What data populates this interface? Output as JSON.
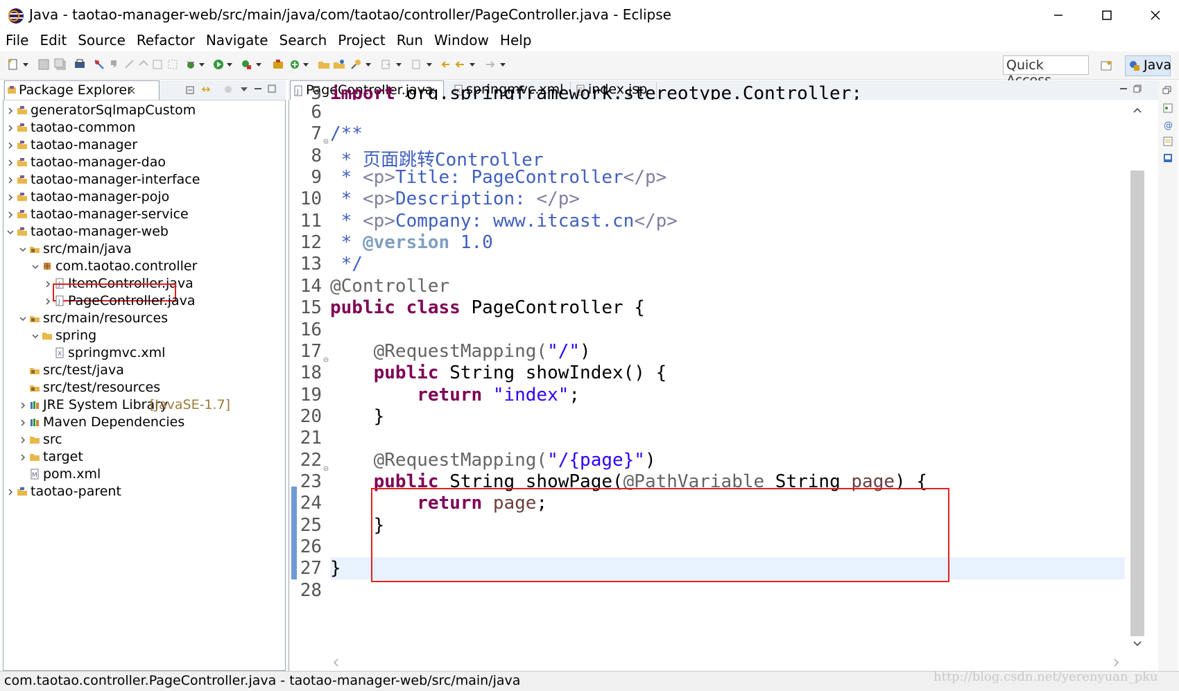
{
  "window": {
    "title": "Java - taotao-manager-web/src/main/java/com/taotao/controller/PageController.java - Eclipse"
  },
  "menu": [
    "File",
    "Edit",
    "Source",
    "Refactor",
    "Navigate",
    "Search",
    "Project",
    "Run",
    "Window",
    "Help"
  ],
  "toolbar": {
    "quick_access": "Quick Access",
    "perspective": "Java"
  },
  "package_explorer": {
    "title": "Package Explorer",
    "items": [
      {
        "label": "generatorSqlmapCustom",
        "icon": "project-icon"
      },
      {
        "label": "taotao-common",
        "icon": "project-icon"
      },
      {
        "label": "taotao-manager",
        "icon": "project-icon"
      },
      {
        "label": "taotao-manager-dao",
        "icon": "project-icon"
      },
      {
        "label": "taotao-manager-interface",
        "icon": "project-icon"
      },
      {
        "label": "taotao-manager-pojo",
        "icon": "project-icon"
      },
      {
        "label": "taotao-manager-service",
        "icon": "project-icon"
      },
      {
        "label": "taotao-manager-web",
        "icon": "project-icon"
      },
      {
        "label": "src/main/java",
        "icon": "source-folder-icon"
      },
      {
        "label": "com.taotao.controller",
        "icon": "package-icon"
      },
      {
        "label": "ItemController.java",
        "icon": "java-file-icon"
      },
      {
        "label": "PageController.java",
        "icon": "java-file-icon"
      },
      {
        "label": "src/main/resources",
        "icon": "source-folder-icon"
      },
      {
        "label": "spring",
        "icon": "folder-icon"
      },
      {
        "label": "springmvc.xml",
        "icon": "xml-file-icon"
      },
      {
        "label": "src/test/java",
        "icon": "source-folder-icon"
      },
      {
        "label": "src/test/resources",
        "icon": "source-folder-icon"
      },
      {
        "label": "JRE System Library",
        "suffix": "[JavaSE-1.7]",
        "icon": "library-icon"
      },
      {
        "label": "Maven Dependencies",
        "icon": "library-icon"
      },
      {
        "label": "src",
        "icon": "folder-icon"
      },
      {
        "label": "target",
        "icon": "folder-icon"
      },
      {
        "label": "pom.xml",
        "icon": "xml-file-icon"
      },
      {
        "label": "taotao-parent",
        "icon": "project-icon"
      }
    ]
  },
  "editor": {
    "tabs": [
      {
        "label": "PageController.java",
        "active": true
      },
      {
        "label": "springmvc.xml",
        "active": false
      },
      {
        "label": "index.jsp",
        "active": false
      }
    ],
    "line_numbers": [
      "5",
      "6",
      "7",
      "8",
      "9",
      "10",
      "11",
      "12",
      "13",
      "14",
      "15",
      "16",
      "17",
      "18",
      "19",
      "20",
      "21",
      "22",
      "23",
      "24",
      "25",
      "26",
      "27",
      "28"
    ],
    "code": {
      "l5a": "import ",
      "l5b": "org.springframework.stereotype.Controller;",
      "l7": "/**",
      "l8": " * 页面跳转Controller",
      "l9a": " * ",
      "l9b": "<p>",
      "l9c": "Title: PageController",
      "l9d": "</p>",
      "l10a": " * ",
      "l10b": "<p>",
      "l10c": "Description: ",
      "l10d": "</p>",
      "l11a": " * ",
      "l11b": "<p>",
      "l11c": "Company: www.itcast.cn",
      "l11d": "</p>",
      "l12a": " * ",
      "l12b": "@version",
      "l12c": " 1.0",
      "l13": " */",
      "l14": "@Controller",
      "l15a": "public class",
      "l15b": " PageController {",
      "l17a": "    @RequestMapping(",
      "l17b": "\"/\"",
      "l17c": ")",
      "l18a": "    ",
      "l18b": "public",
      "l18c": " String showIndex() {",
      "l19a": "        ",
      "l19b": "return",
      "l19c": " ",
      "l19d": "\"index\"",
      "l19e": ";",
      "l20": "    }",
      "l22a": "    @RequestMapping(",
      "l22b": "\"/{page}\"",
      "l22c": ")",
      "l23a": "    ",
      "l23b": "public",
      "l23c": " String showPage(",
      "l23d": "@PathVariable",
      "l23e": " String ",
      "l23f": "page",
      "l23g": ") {",
      "l24a": "        ",
      "l24b": "return",
      "l24c": " ",
      "l24d": "page",
      "l24e": ";",
      "l25": "    }",
      "l27": "}"
    }
  },
  "status_bar": {
    "text": "com.taotao.controller.PageController.java - taotao-manager-web/src/main/java",
    "watermark": "http://blog.csdn.net/yerenyuan_pku"
  },
  "colors": {
    "keyword": "#7f0055",
    "comment": "#3f5fbf",
    "string": "#2a00ff",
    "annotation": "#646464",
    "highlight_box": "#e0201f"
  }
}
